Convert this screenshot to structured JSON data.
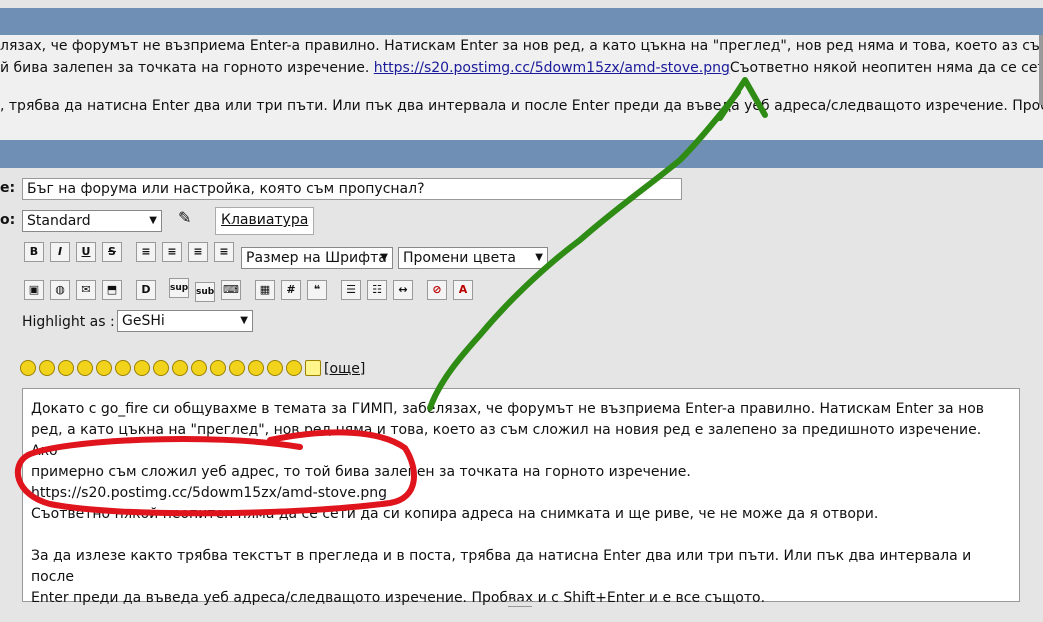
{
  "preview": {
    "line1": "лязах, че форумът не възприема Enter-а правилно. Натискам Enter за нов ред, а като цъкна на \"преглед\", нов ред няма и това, което аз съм",
    "line2_prefix": "й бива залепен за точката на горното изречение. ",
    "line2_link": "https://s20.postimg.cc/5dowm15zx/amd-stove.png",
    "line2_suffix": "Съответно някой неопитен няма да се сети",
    "line3": ", трябва да натисна Enter два или три пъти. Или пък два интервала и после Enter преди да въведа уеб адреса/следващото изречение. Проб"
  },
  "form": {
    "subject_label": "е:",
    "subject_value": "Бъг на форума или настройка, която съм пропуснал?",
    "icon_label": "о:",
    "style_select": "Standard",
    "keyboard_button": "Клавиатура",
    "font_size_select": "Размер на Шрифта",
    "color_select": "Промени цвета",
    "highlight_label": "Highlight as :",
    "highlight_select": "GeSHi",
    "more_smileys": "[още]",
    "toolbar1": [
      "B",
      "I",
      "U",
      "S"
    ],
    "toolbar2_labels": [
      "sup",
      "sub"
    ]
  },
  "message": {
    "p1_line1": "Докато с go_fire си общувахме в темата за ГИМП, забелязах, че форумът не възприема Enter-а правилно. Натискам Enter за нов",
    "p1_line2": "ред, а като цъкна на \"преглед\", нов ред няма и това, което аз съм сложил на новия ред е залепено за предишното изречение. Ако",
    "p1_line3": "примерно съм сложил уеб адрес, то той бива залепен за точката на горното изречение.",
    "p1_line4": "https://s20.postimg.cc/5dowm15zx/amd-stove.png",
    "p1_line5": "Съответно някой неопитен няма да се сети да си копира адреса на снимката и ще риве, че не може да я отвори.",
    "p2_line1": "За да излезе както трябва текстът в прегледа и в поста, трябва да натисна Enter два или три пъти. Или пък два интервала и после",
    "p2_line2": "Enter преди да въведа уеб адреса/следващото изречение. Пробвах и с Shift+Enter и е все същото."
  },
  "colors": {
    "header_bar": "#6f8fb4",
    "annotation_red": "#e0141c",
    "annotation_green": "#2e8b14"
  }
}
